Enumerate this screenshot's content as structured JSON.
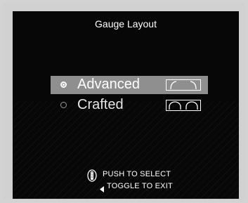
{
  "title": "Gauge Layout",
  "options": [
    {
      "label": "Advanced",
      "selected": true,
      "preview_icon": "advanced-gauge-preview-icon"
    },
    {
      "label": "Crafted",
      "selected": false,
      "preview_icon": "crafted-gauge-preview-icon"
    }
  ],
  "hints": {
    "select": "PUSH TO SELECT",
    "exit": "TOGGLE TO EXIT",
    "select_icon": "selector-wheel-icon",
    "exit_icon": "left-arrow-icon"
  },
  "colors": {
    "screen_bg": "#070707",
    "highlight": "#8f8f8f",
    "text": "#ffffff",
    "frame": "#d1d1d1"
  }
}
